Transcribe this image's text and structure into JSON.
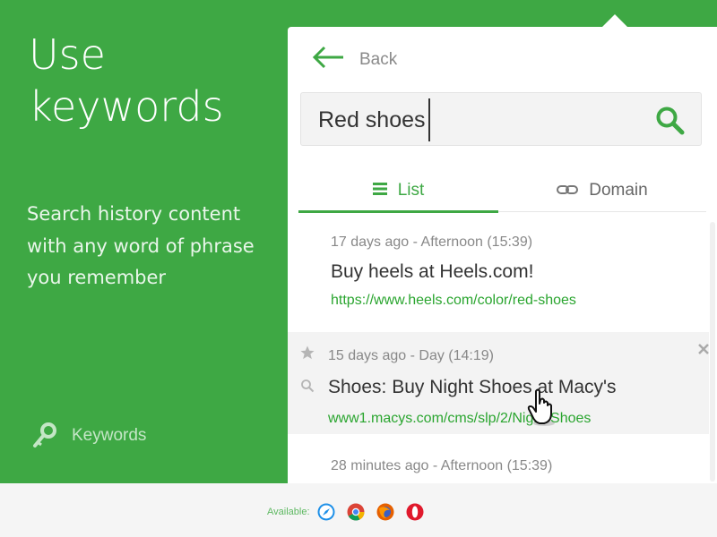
{
  "promo": {
    "title_line1": "Use",
    "title_line2": "keywords",
    "description": "Search history content with any word of phrase you remember",
    "feature_label": "Keywords"
  },
  "panel": {
    "back_label": "Back",
    "search": {
      "value": "Red shoes"
    },
    "tabs": [
      {
        "label": "List",
        "active": true
      },
      {
        "label": "Domain",
        "active": false
      }
    ],
    "items": [
      {
        "meta": "17 days ago - Afternoon (15:39)",
        "title": "Buy heels at Heels.com!",
        "url": "https://www.heels.com/color/red-shoes"
      },
      {
        "meta": "15 days ago - Day (14:19)",
        "title": "Shoes: Buy Night Shoes at Macy's",
        "url": "www1.macys.com/cms/slp/2/Night-Shoes"
      },
      {
        "meta": "28 minutes ago - Afternoon (15:39)"
      }
    ]
  },
  "footer": {
    "available_label": "Available:",
    "browsers": [
      "safari-icon",
      "chrome-icon",
      "firefox-icon",
      "opera-icon"
    ]
  },
  "colors": {
    "brand_green": "#3ea844",
    "link_green": "#2aa52f"
  }
}
